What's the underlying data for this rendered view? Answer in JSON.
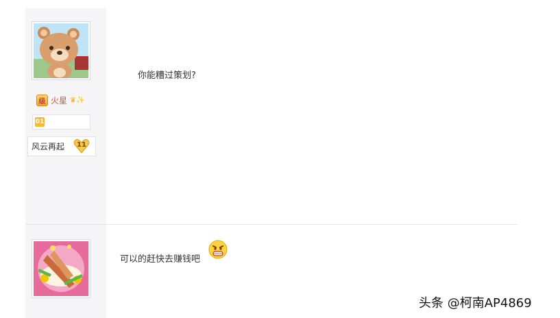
{
  "post1": {
    "user_rank": "火星",
    "user_title": "风云再起",
    "user_level": "11",
    "message": "你能糟过策划?"
  },
  "post2": {
    "message": "可以的赶快去赚钱吧",
    "emoji": "angry-grin-emoticon"
  },
  "watermark": "头条 @柯南AP4869",
  "colors": {
    "sidebar_bg": "#f5f5f7",
    "rank_text": "#e2502d",
    "divider": "#e6e6ea"
  }
}
